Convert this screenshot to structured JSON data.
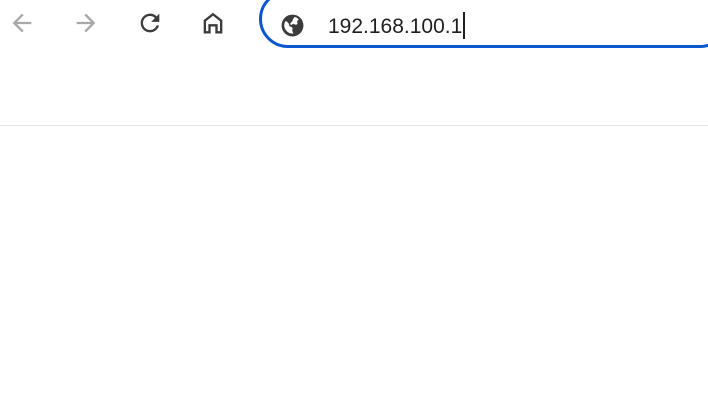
{
  "toolbar": {
    "back_icon": "arrow-left-icon",
    "forward_icon": "arrow-right-icon",
    "reload_icon": "reload-icon",
    "home_icon": "home-icon",
    "disabled_icon_color": "#a8a8a8",
    "active_icon_color": "#3c3c3c"
  },
  "omnibox": {
    "site_icon": "globe-icon",
    "url": "192.168.100.1",
    "focus_border_color": "#0b57d0",
    "focused": true
  },
  "page": {
    "background": "#ffffff"
  }
}
